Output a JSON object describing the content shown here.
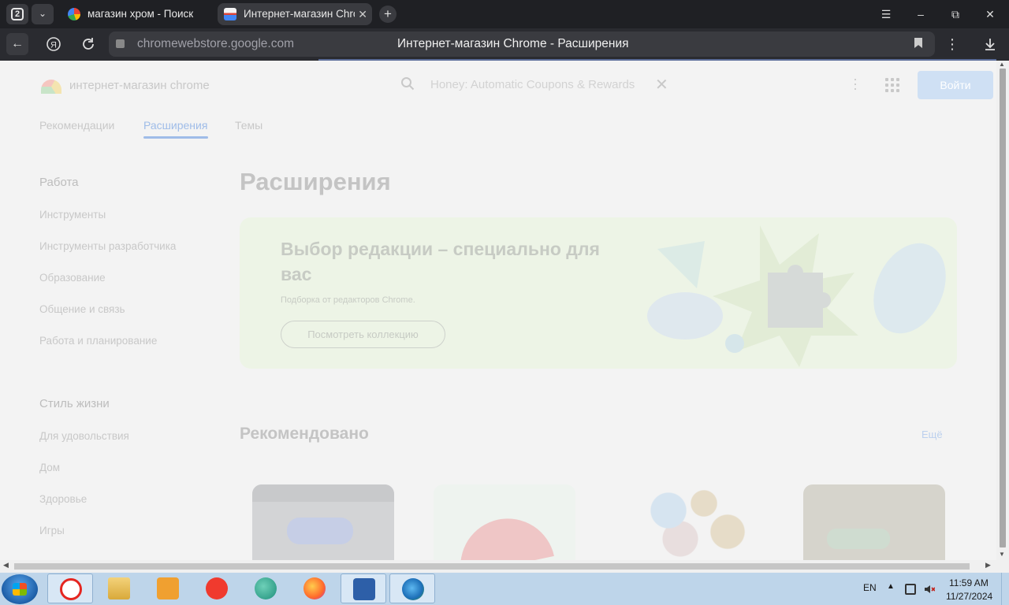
{
  "browser": {
    "tab_count": "2",
    "tabs": [
      {
        "title": "магазин хром - Поиск в Google",
        "active": false
      },
      {
        "title": "Интернет-магазин Chrome",
        "active": true
      }
    ],
    "new_tab_label": "+",
    "window_controls": {
      "menu": "☰",
      "minimize": "–",
      "restore": "⧉",
      "close": "✕"
    },
    "url": "chromewebstore.google.com",
    "page_title": "Интернет-магазин Chrome - Расширения"
  },
  "store": {
    "logo_text": "интернет-магазин chrome",
    "search_value": "Honey: Automatic Coupons & Rewards",
    "signin_label": "Войти",
    "nav_tabs": [
      "Рекомендации",
      "Расширения",
      "Темы"
    ],
    "active_tab": "Расширения",
    "sidebar": {
      "work_title": "Работа",
      "work_items": [
        "Инструменты",
        "Инструменты разработчика",
        "Образование",
        "Общение и связь",
        "Работа и планирование"
      ],
      "life_title": "Стиль жизни",
      "life_items": [
        "Для удовольствия",
        "Дом",
        "Здоровье",
        "Игры"
      ]
    },
    "heading": "Расширения",
    "banner": {
      "title": "Выбор редакции – специально для вас",
      "subtitle": "Подборка от редакторов Chrome.",
      "button": "Посмотреть коллекцию"
    },
    "recommended_title": "Рекомендовано",
    "recommended_more": "Ещё"
  },
  "taskbar": {
    "language": "EN",
    "time": "11:59 AM",
    "date": "11/27/2024",
    "pinned": [
      "yandex-browser-icon",
      "file-explorer-icon",
      "media-player-icon",
      "yandex-icon",
      "chat-icon",
      "firefox-icon",
      "virtualbox-icon",
      "internet-download-manager-icon"
    ]
  }
}
